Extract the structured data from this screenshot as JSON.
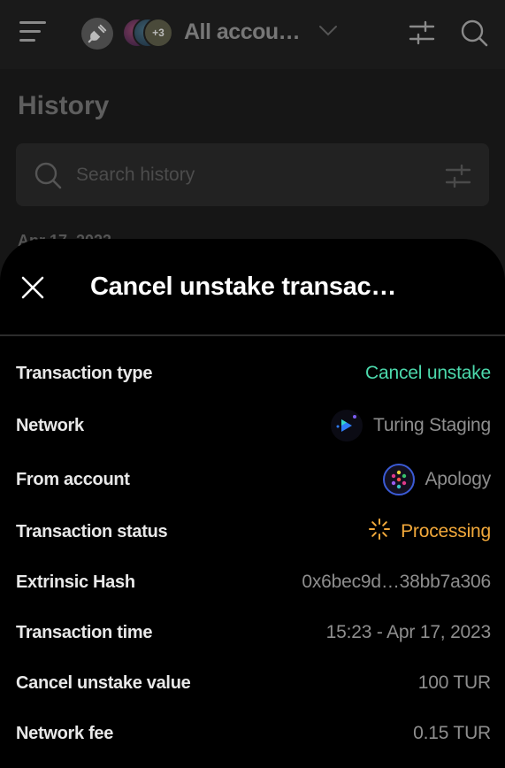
{
  "header": {
    "account_name": "All accou…",
    "avatar_more_count": "+3",
    "icons": [
      "menu-icon",
      "plug-icon",
      "chevron-down-icon",
      "filter-icon",
      "search-icon"
    ]
  },
  "page": {
    "title": "History",
    "search_placeholder": "Search history",
    "date_peek": "Apr 17, 2023"
  },
  "sheet": {
    "title": "Cancel unstake transac…",
    "rows": [
      {
        "label": "Transaction type",
        "value": "Cancel unstake"
      },
      {
        "label": "Network",
        "value": "Turing Staging"
      },
      {
        "label": "From account",
        "value": "Apology"
      },
      {
        "label": "Transaction status",
        "value": "Processing"
      },
      {
        "label": "Extrinsic Hash",
        "value": "0x6bec9d…38bb7a306"
      },
      {
        "label": "Transaction time",
        "value": "15:23 - Apr 17, 2023"
      },
      {
        "label": "Cancel unstake value",
        "value": "100 TUR"
      },
      {
        "label": "Network fee",
        "value": "0.15 TUR"
      }
    ]
  },
  "colors": {
    "success_green": "#4cd9ac",
    "processing_orange": "#f2a93b",
    "sheet_bg": "#000000",
    "backdrop": "#161616"
  }
}
